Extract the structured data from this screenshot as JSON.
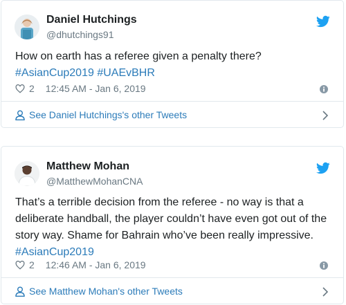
{
  "tweets": [
    {
      "author_name": "Daniel Hutchings",
      "handle": "@dhutchings91",
      "text_lines": [
        "How on earth has a referee given a penalty there?"
      ],
      "hashtags": [
        "#AsianCup2019",
        "#UAEvBHR"
      ],
      "likes": "2",
      "timestamp": "12:45 AM - Jan 6, 2019",
      "other_tweets_link": "See Daniel Hutchings's other Tweets"
    },
    {
      "author_name": "Matthew Mohan",
      "handle": "@MatthewMohanCNA",
      "text_lines": [
        "That’s a terrible decision from the referee - no way is that a",
        "deliberate handball, the player couldn’t have even got out of the",
        "story way. Shame for Bahrain who’ve been really impressive."
      ],
      "hashtags": [
        "#AsianCup2019"
      ],
      "likes": "2",
      "timestamp": "12:46 AM - Jan 6, 2019",
      "other_tweets_link": "See Matthew Mohan's other Tweets"
    }
  ],
  "icons": {
    "bird": "twitter-bird-icon",
    "heart": "heart-icon",
    "info": "info-icon",
    "person": "person-icon",
    "chevron": "chevron-right-icon"
  },
  "colors": {
    "link": "#2b7bb9",
    "bird": "#1da1f2",
    "muted": "#697882",
    "border": "#e1e8ed"
  }
}
